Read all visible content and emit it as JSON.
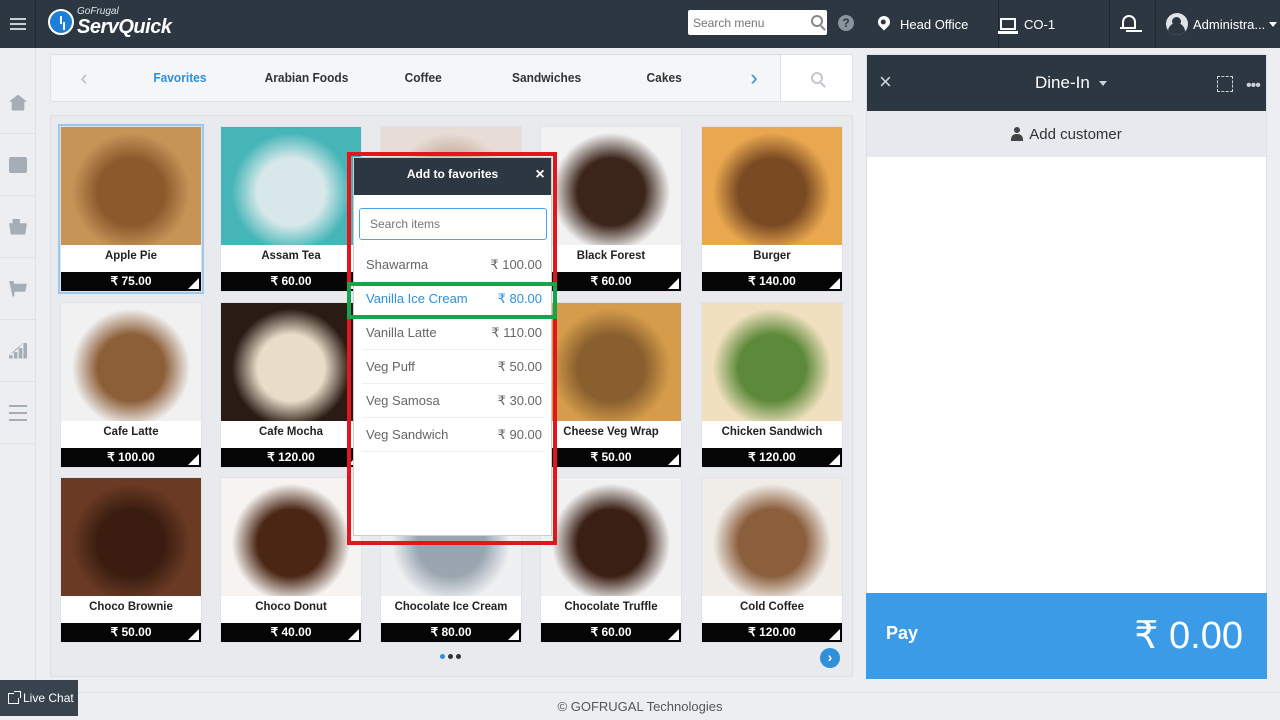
{
  "app": {
    "brand_small": "GoFrugal",
    "brand_big": "ServQuick"
  },
  "header": {
    "search_placeholder": "Search menu",
    "help_label": "?",
    "location": "Head Office",
    "counter": "CO-1",
    "user": "Administra..."
  },
  "categories": {
    "tabs": [
      "Favorites",
      "Arabian Foods",
      "Coffee",
      "Sandwiches",
      "Cakes"
    ],
    "active": "Favorites",
    "prev_glyph": "‹",
    "next_glyph": "›"
  },
  "products": [
    {
      "name": "Apple Pie",
      "price": "₹ 75.00",
      "colors": [
        "#c79458",
        "#8a5a2c"
      ]
    },
    {
      "name": "Assam Tea",
      "price": "₹ 60.00",
      "colors": [
        "#46b5b8",
        "#d8e8ea"
      ]
    },
    {
      "name": "",
      "price": "",
      "colors": [
        "#e8ddd6",
        "#c4a999"
      ]
    },
    {
      "name": "Black Forest",
      "price": "₹ 60.00",
      "colors": [
        "#f2f2f2",
        "#3b2419"
      ]
    },
    {
      "name": "Burger",
      "price": "₹ 140.00",
      "colors": [
        "#e9a850",
        "#7a4a22"
      ]
    },
    {
      "name": "Cafe Latte",
      "price": "₹ 100.00",
      "colors": [
        "#f1f1f1",
        "#8d5f39"
      ]
    },
    {
      "name": "Cafe Mocha",
      "price": "₹ 120.00",
      "colors": [
        "#2a1b14",
        "#e9dcc8"
      ]
    },
    {
      "name": "",
      "price": "",
      "colors": [
        "#f2f2f2",
        "#d9d9d9"
      ]
    },
    {
      "name": "Cheese Veg Wrap",
      "price": "₹ 50.00",
      "colors": [
        "#d49c4b",
        "#8a5f2e"
      ]
    },
    {
      "name": "Chicken Sandwich",
      "price": "₹ 120.00",
      "colors": [
        "#f0e0bf",
        "#5d8a3a"
      ]
    },
    {
      "name": "Choco Brownie",
      "price": "₹ 50.00",
      "colors": [
        "#6a3a24",
        "#3a1d10"
      ]
    },
    {
      "name": "Choco Donut",
      "price": "₹ 40.00",
      "colors": [
        "#f6f3f0",
        "#4a2615"
      ]
    },
    {
      "name": "Chocolate Ice Cream",
      "price": "₹ 80.00",
      "colors": [
        "#eef0f2",
        "#9aa5b0"
      ]
    },
    {
      "name": "Chocolate Truffle",
      "price": "₹ 60.00",
      "colors": [
        "#f1f1f1",
        "#3a1f14"
      ]
    },
    {
      "name": "Cold Coffee",
      "price": "₹ 120.00",
      "colors": [
        "#f0ede9",
        "#8b5e3c"
      ]
    }
  ],
  "pagination": {
    "pages": 3,
    "current": 1,
    "next_glyph": "›"
  },
  "popup": {
    "title": "Add to favorites",
    "close_glyph": "×",
    "search_placeholder": "Search items",
    "items": [
      {
        "name": "Shawarma",
        "price": "₹ 100.00",
        "highlighted": false
      },
      {
        "name": "Vanilla Ice Cream",
        "price": "₹ 80.00",
        "highlighted": true
      },
      {
        "name": "Vanilla Latte",
        "price": "₹ 110.00",
        "highlighted": false
      },
      {
        "name": "Veg Puff",
        "price": "₹ 50.00",
        "highlighted": false
      },
      {
        "name": "Veg Samosa",
        "price": "₹ 30.00",
        "highlighted": false
      },
      {
        "name": "Veg Sandwich",
        "price": "₹ 90.00",
        "highlighted": false
      }
    ]
  },
  "order": {
    "close_glyph": "×",
    "mode": "Dine-In",
    "more_glyph": "•••",
    "add_customer": "Add customer",
    "pay_label": "Pay",
    "total": "₹ 0.00"
  },
  "footer": {
    "copyright": "© GOFRUGAL Technologies",
    "live_chat": "Live Chat"
  },
  "colors": {
    "accent": "#2f8fd8",
    "topbar": "#2d3741",
    "pay": "#3b9be6",
    "annotation_red": "#e2161d",
    "annotation_green": "#16a54a"
  }
}
